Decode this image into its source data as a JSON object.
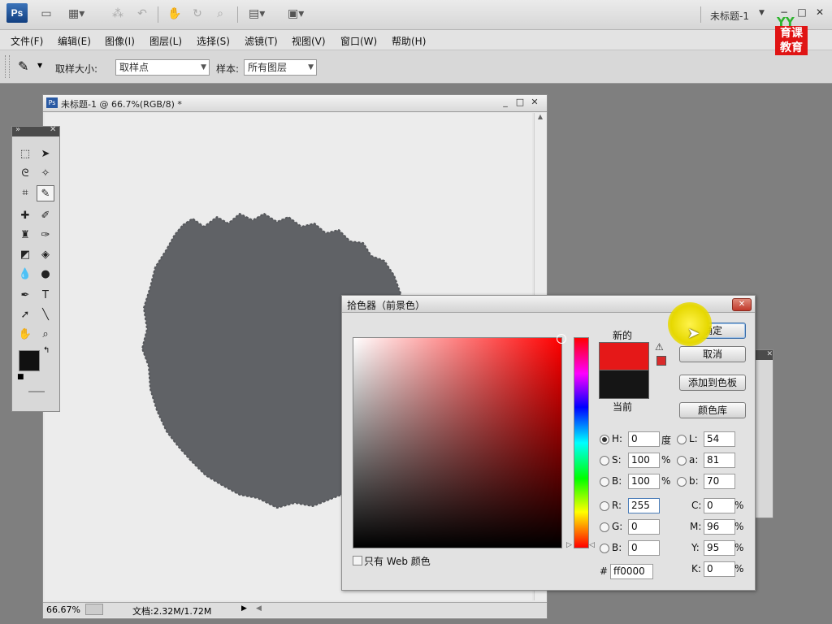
{
  "app": {
    "logo": "Ps",
    "doc_title": "未标题-1",
    "brand_top": "YY",
    "brand_line1": "育课",
    "brand_line2": "教育"
  },
  "menu": [
    "文件(F)",
    "编辑(E)",
    "图像(I)",
    "图层(L)",
    "选择(S)",
    "滤镜(T)",
    "视图(V)",
    "窗口(W)",
    "帮助(H)"
  ],
  "options": {
    "sample_size_label": "取样大小:",
    "sample_size_value": "取样点",
    "sample_label": "样本:",
    "sample_value": "所有图层"
  },
  "document": {
    "title": "未标题-1 @ 66.7%(RGB/8) *",
    "zoom": "66.67%",
    "doc_info": "文档:2.32M/1.72M"
  },
  "picker": {
    "title": "拾色器（前景色）",
    "new_label": "新的",
    "current_label": "当前",
    "ok": "确定",
    "cancel": "取消",
    "add_swatch": "添加到色板",
    "color_libraries": "颜色库",
    "web_only": "只有 Web 颜色",
    "hsb": {
      "H": "0",
      "H_unit": "度",
      "S": "100",
      "S_unit": "%",
      "B": "100",
      "B_unit": "%"
    },
    "rgb": {
      "R": "255",
      "G": "0",
      "B": "0"
    },
    "lab": {
      "L": "54",
      "a": "81",
      "b": "70"
    },
    "cmyk": {
      "C": "0",
      "M": "96",
      "Y": "95",
      "K": "0",
      "unit": "%"
    },
    "hex": "ff0000",
    "hex_label": "#",
    "new_color": "#e51818",
    "current_color": "#151515"
  }
}
